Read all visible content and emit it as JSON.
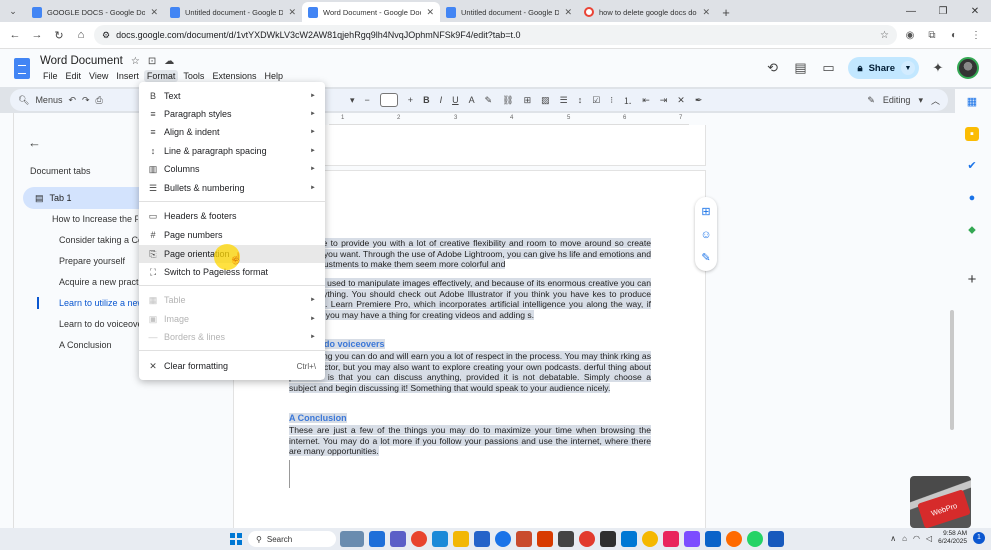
{
  "browser": {
    "tabs": [
      {
        "title": "GOOGLE DOCS - Google Docs",
        "active": false
      },
      {
        "title": "Untitled document - Google Docs",
        "active": false
      },
      {
        "title": "Word Document - Google Docs",
        "active": true
      },
      {
        "title": "Untitled document - Google Docs",
        "active": false
      },
      {
        "title": "how to delete google docs docum",
        "active": false
      }
    ],
    "url": "docs.google.com/document/d/1vtYXDWkLV3cW2AW81qjehRgq9lh4NvqJOphmNFSk9F4/edit?tab=t.0"
  },
  "docs": {
    "title": "Word Document",
    "menus": [
      "File",
      "Edit",
      "View",
      "Insert",
      "Format",
      "Tools",
      "Extensions",
      "Help"
    ],
    "share_label": "Share",
    "toolbar": {
      "menus_label": "Menus",
      "editing_label": "Editing"
    }
  },
  "outline": {
    "heading": "Document tabs",
    "tab_label": "Tab 1",
    "items": [
      {
        "label": "How to Increase the Pro",
        "selected": false
      },
      {
        "label": "Consider taking a Cou",
        "selected": false
      },
      {
        "label": "Prepare yourself",
        "selected": false
      },
      {
        "label": "Acquire a new practic",
        "selected": false
      },
      {
        "label": "Learn to utilize a new",
        "selected": true
      },
      {
        "label": "Learn to do voiceover",
        "selected": false
      },
      {
        "label": "A Conclusion",
        "selected": false
      }
    ]
  },
  "ruler_ticks": [
    "1",
    "2",
    "3",
    "4",
    "5",
    "6",
    "7"
  ],
  "format_menu": {
    "items": [
      {
        "icon": "B",
        "label": "Text",
        "submenu": true,
        "disabled": false
      },
      {
        "icon": "≡",
        "label": "Paragraph styles",
        "submenu": true,
        "disabled": false
      },
      {
        "icon": "≡",
        "label": "Align & indent",
        "submenu": true,
        "disabled": false
      },
      {
        "icon": "↕",
        "label": "Line & paragraph spacing",
        "submenu": true,
        "disabled": false
      },
      {
        "icon": "▥",
        "label": "Columns",
        "submenu": true,
        "disabled": false
      },
      {
        "icon": "☰",
        "label": "Bullets & numbering",
        "submenu": true,
        "disabled": false
      },
      {
        "icon": "▭",
        "label": "Headers & footers",
        "submenu": false,
        "disabled": false
      },
      {
        "icon": "#",
        "label": "Page numbers",
        "submenu": false,
        "disabled": false
      },
      {
        "icon": "⎘",
        "label": "Page orientation",
        "submenu": false,
        "disabled": false,
        "hover": true
      },
      {
        "icon": "⛶",
        "label": "Switch to Pageless format",
        "submenu": false,
        "disabled": false
      },
      {
        "icon": "▦",
        "label": "Table",
        "submenu": true,
        "disabled": true
      },
      {
        "icon": "▣",
        "label": "Image",
        "submenu": true,
        "disabled": true
      },
      {
        "icon": "—",
        "label": "Borders & lines",
        "submenu": true,
        "disabled": true
      },
      {
        "icon": "✕",
        "label": "Clear formatting",
        "submenu": false,
        "disabled": false,
        "shortcut": "Ctrl+\\"
      }
    ]
  },
  "document": {
    "para1": "akes care to provide you with a lot of creative flexibility and room to move around so create anything you want. Through the use of Adobe Lightroom, you can give hs life and emotions and make adjustments to make them seem more colorful and",
    "para2": "o may be used to manipulate images effectively, and because of its enormous creative you can make anything. You should check out Adobe Illustrator if you think you have kes to produce digital art. Learn Premiere Pro, which incorporates artificial intelligence you along the way, if you think you may have a thing for creating videos and adding s.",
    "heading3": "do voiceovers",
    "para3": "asiest thing you can do and will earn you a lot of respect in the process. You may think rking as a voice actor, but you may also want to explore creating your own podcasts. derful thing about podcasts is that you can discuss anything, provided it is not debatable. Simply choose a subject and begin discussing it! Something that would speak to your audience nicely.",
    "heading4": "A Conclusion",
    "para4": "These are just a few of the things you may do to maximize your time when browsing the internet. You may do a lot more if you follow your passions and use the internet, where there are many opportunities."
  },
  "overlay": {
    "badge": "WebPro"
  },
  "taskbar": {
    "search_label": "Search",
    "time": "9:58 AM",
    "date": "6/24/2025",
    "notifications": "1"
  }
}
